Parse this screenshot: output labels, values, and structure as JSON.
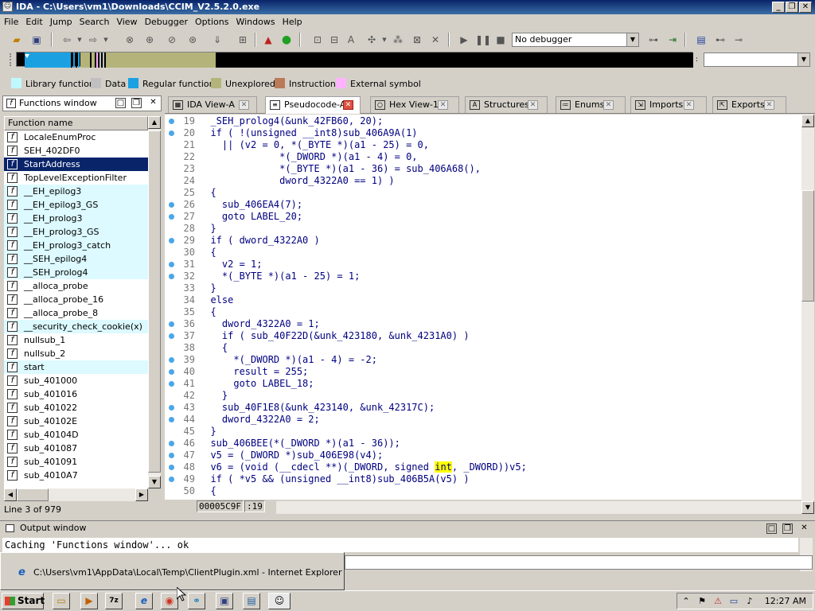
{
  "window": {
    "title": "IDA - C:\\Users\\vm1\\Downloads\\CCIM_V2.5.2.0.exe"
  },
  "menu": [
    "File",
    "Edit",
    "Jump",
    "Search",
    "View",
    "Debugger",
    "Options",
    "Windows",
    "Help"
  ],
  "toolbar": {
    "debugger_select": "No debugger"
  },
  "legend": [
    {
      "label": "Library function",
      "color": "#c0f8ff"
    },
    {
      "label": "Data",
      "color": "#c0c0c0"
    },
    {
      "label": "Regular function",
      "color": "#1ba1e2"
    },
    {
      "label": "Unexplored",
      "color": "#b4b47a"
    },
    {
      "label": "Instruction",
      "color": "#b97a57"
    },
    {
      "label": "External symbol",
      "color": "#ffb3ff"
    }
  ],
  "functions_window": {
    "title": "Functions window",
    "column": "Function name",
    "items": [
      {
        "name": "LocaleEnumProc",
        "type": "regular"
      },
      {
        "name": "SEH_402DF0",
        "type": "regular"
      },
      {
        "name": "StartAddress",
        "type": "selected"
      },
      {
        "name": "TopLevelExceptionFilter",
        "type": "regular"
      },
      {
        "name": "__EH_epilog3",
        "type": "library"
      },
      {
        "name": "__EH_epilog3_GS",
        "type": "library"
      },
      {
        "name": "__EH_prolog3",
        "type": "library"
      },
      {
        "name": "__EH_prolog3_GS",
        "type": "library"
      },
      {
        "name": "__EH_prolog3_catch",
        "type": "library"
      },
      {
        "name": "__SEH_epilog4",
        "type": "library"
      },
      {
        "name": "__SEH_prolog4",
        "type": "library"
      },
      {
        "name": "__alloca_probe",
        "type": "regular"
      },
      {
        "name": "__alloca_probe_16",
        "type": "regular"
      },
      {
        "name": "__alloca_probe_8",
        "type": "regular"
      },
      {
        "name": "__security_check_cookie(x)",
        "type": "library"
      },
      {
        "name": "nullsub_1",
        "type": "regular"
      },
      {
        "name": "nullsub_2",
        "type": "regular"
      },
      {
        "name": "start",
        "type": "library"
      },
      {
        "name": "sub_401000",
        "type": "regular"
      },
      {
        "name": "sub_401016",
        "type": "regular"
      },
      {
        "name": "sub_401022",
        "type": "regular"
      },
      {
        "name": "sub_40102E",
        "type": "regular"
      },
      {
        "name": "sub_40104D",
        "type": "regular"
      },
      {
        "name": "sub_401087",
        "type": "regular"
      },
      {
        "name": "sub_401091",
        "type": "regular"
      },
      {
        "name": "sub_4010A7",
        "type": "regular"
      }
    ],
    "status": "Line 3 of 979"
  },
  "tabs": [
    {
      "label": "IDA View-A",
      "icon": "ida-view-icon",
      "active": false
    },
    {
      "label": "Pseudocode-A",
      "icon": "pseudocode-icon",
      "active": true
    },
    {
      "label": "Hex View-1",
      "icon": "hex-view-icon",
      "active": false
    },
    {
      "label": "Structures",
      "icon": "structures-icon",
      "active": false
    },
    {
      "label": "Enums",
      "icon": "enums-icon",
      "active": false
    },
    {
      "label": "Imports",
      "icon": "imports-icon",
      "active": false
    },
    {
      "label": "Exports",
      "icon": "exports-icon",
      "active": false
    }
  ],
  "code": [
    {
      "n": "19",
      "dot": true,
      "text": "  _SEH_prolog4(&unk_42FB60, 20);"
    },
    {
      "n": "20",
      "dot": true,
      "text": "  if ( !(unsigned __int8)sub_406A9A(1)"
    },
    {
      "n": "21",
      "dot": false,
      "text": "    || (v2 = 0, *(_BYTE *)(a1 - 25) = 0,"
    },
    {
      "n": "22",
      "dot": false,
      "text": "              *(_DWORD *)(a1 - 4) = 0,"
    },
    {
      "n": "23",
      "dot": false,
      "text": "              *(_BYTE *)(a1 - 36) = sub_406A68(),"
    },
    {
      "n": "24",
      "dot": false,
      "text": "              dword_4322A0 == 1) )"
    },
    {
      "n": "25",
      "dot": false,
      "text": "  {"
    },
    {
      "n": "26",
      "dot": true,
      "text": "    sub_406EA4(7);"
    },
    {
      "n": "27",
      "dot": true,
      "text": "    goto LABEL_20;"
    },
    {
      "n": "28",
      "dot": false,
      "text": "  }"
    },
    {
      "n": "29",
      "dot": true,
      "text": "  if ( dword_4322A0 )"
    },
    {
      "n": "30",
      "dot": false,
      "text": "  {"
    },
    {
      "n": "31",
      "dot": true,
      "text": "    v2 = 1;"
    },
    {
      "n": "32",
      "dot": true,
      "text": "    *(_BYTE *)(a1 - 25) = 1;"
    },
    {
      "n": "33",
      "dot": false,
      "text": "  }"
    },
    {
      "n": "34",
      "dot": false,
      "text": "  else"
    },
    {
      "n": "35",
      "dot": false,
      "text": "  {"
    },
    {
      "n": "36",
      "dot": true,
      "text": "    dword_4322A0 = 1;"
    },
    {
      "n": "37",
      "dot": true,
      "text": "    if ( sub_40F22D(&unk_423180, &unk_4231A0) )"
    },
    {
      "n": "38",
      "dot": false,
      "text": "    {"
    },
    {
      "n": "39",
      "dot": true,
      "text": "      *(_DWORD *)(a1 - 4) = -2;"
    },
    {
      "n": "40",
      "dot": true,
      "text": "      result = 255;"
    },
    {
      "n": "41",
      "dot": true,
      "text": "      goto LABEL_18;"
    },
    {
      "n": "42",
      "dot": false,
      "text": "    }"
    },
    {
      "n": "43",
      "dot": true,
      "text": "    sub_40F1E8(&unk_423140, &unk_42317C);"
    },
    {
      "n": "44",
      "dot": true,
      "text": "    dword_4322A0 = 2;"
    },
    {
      "n": "45",
      "dot": false,
      "text": "  }"
    },
    {
      "n": "46",
      "dot": true,
      "text": "  sub_406BEE(*(_DWORD *)(a1 - 36));"
    },
    {
      "n": "47",
      "dot": true,
      "text": "  v5 = (_DWORD *)sub_406E98(v4);"
    },
    {
      "n": "48",
      "dot": true,
      "text": "  v6 = (void (__cdecl **)(_DWORD, signed int, _DWORD))v5;"
    },
    {
      "n": "49",
      "dot": true,
      "text": "  if ( *v5 && (unsigned __int8)sub_406B5A(v5) )"
    },
    {
      "n": "50",
      "dot": false,
      "text": "  {"
    }
  ],
  "code_highlight": "int",
  "code_status": {
    "address": "00005C9F",
    "line": ":19"
  },
  "output": {
    "title": "Output window",
    "text": "Caching 'Functions window'... ok"
  },
  "ie_popup": {
    "text": "C:\\Users\\vm1\\AppData\\Local\\Temp\\ClientPlugin.xml - Internet Explorer"
  },
  "taskbar": {
    "start": "Start",
    "clock": "12:27 AM"
  }
}
